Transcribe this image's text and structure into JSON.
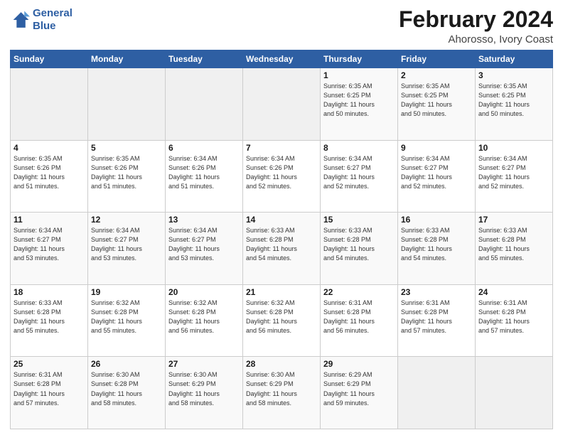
{
  "logo": {
    "line1": "General",
    "line2": "Blue"
  },
  "title": "February 2024",
  "subtitle": "Ahorosso, Ivory Coast",
  "weekdays": [
    "Sunday",
    "Monday",
    "Tuesday",
    "Wednesday",
    "Thursday",
    "Friday",
    "Saturday"
  ],
  "weeks": [
    [
      {
        "day": "",
        "info": ""
      },
      {
        "day": "",
        "info": ""
      },
      {
        "day": "",
        "info": ""
      },
      {
        "day": "",
        "info": ""
      },
      {
        "day": "1",
        "info": "Sunrise: 6:35 AM\nSunset: 6:25 PM\nDaylight: 11 hours\nand 50 minutes."
      },
      {
        "day": "2",
        "info": "Sunrise: 6:35 AM\nSunset: 6:25 PM\nDaylight: 11 hours\nand 50 minutes."
      },
      {
        "day": "3",
        "info": "Sunrise: 6:35 AM\nSunset: 6:25 PM\nDaylight: 11 hours\nand 50 minutes."
      }
    ],
    [
      {
        "day": "4",
        "info": "Sunrise: 6:35 AM\nSunset: 6:26 PM\nDaylight: 11 hours\nand 51 minutes."
      },
      {
        "day": "5",
        "info": "Sunrise: 6:35 AM\nSunset: 6:26 PM\nDaylight: 11 hours\nand 51 minutes."
      },
      {
        "day": "6",
        "info": "Sunrise: 6:34 AM\nSunset: 6:26 PM\nDaylight: 11 hours\nand 51 minutes."
      },
      {
        "day": "7",
        "info": "Sunrise: 6:34 AM\nSunset: 6:26 PM\nDaylight: 11 hours\nand 52 minutes."
      },
      {
        "day": "8",
        "info": "Sunrise: 6:34 AM\nSunset: 6:27 PM\nDaylight: 11 hours\nand 52 minutes."
      },
      {
        "day": "9",
        "info": "Sunrise: 6:34 AM\nSunset: 6:27 PM\nDaylight: 11 hours\nand 52 minutes."
      },
      {
        "day": "10",
        "info": "Sunrise: 6:34 AM\nSunset: 6:27 PM\nDaylight: 11 hours\nand 52 minutes."
      }
    ],
    [
      {
        "day": "11",
        "info": "Sunrise: 6:34 AM\nSunset: 6:27 PM\nDaylight: 11 hours\nand 53 minutes."
      },
      {
        "day": "12",
        "info": "Sunrise: 6:34 AM\nSunset: 6:27 PM\nDaylight: 11 hours\nand 53 minutes."
      },
      {
        "day": "13",
        "info": "Sunrise: 6:34 AM\nSunset: 6:27 PM\nDaylight: 11 hours\nand 53 minutes."
      },
      {
        "day": "14",
        "info": "Sunrise: 6:33 AM\nSunset: 6:28 PM\nDaylight: 11 hours\nand 54 minutes."
      },
      {
        "day": "15",
        "info": "Sunrise: 6:33 AM\nSunset: 6:28 PM\nDaylight: 11 hours\nand 54 minutes."
      },
      {
        "day": "16",
        "info": "Sunrise: 6:33 AM\nSunset: 6:28 PM\nDaylight: 11 hours\nand 54 minutes."
      },
      {
        "day": "17",
        "info": "Sunrise: 6:33 AM\nSunset: 6:28 PM\nDaylight: 11 hours\nand 55 minutes."
      }
    ],
    [
      {
        "day": "18",
        "info": "Sunrise: 6:33 AM\nSunset: 6:28 PM\nDaylight: 11 hours\nand 55 minutes."
      },
      {
        "day": "19",
        "info": "Sunrise: 6:32 AM\nSunset: 6:28 PM\nDaylight: 11 hours\nand 55 minutes."
      },
      {
        "day": "20",
        "info": "Sunrise: 6:32 AM\nSunset: 6:28 PM\nDaylight: 11 hours\nand 56 minutes."
      },
      {
        "day": "21",
        "info": "Sunrise: 6:32 AM\nSunset: 6:28 PM\nDaylight: 11 hours\nand 56 minutes."
      },
      {
        "day": "22",
        "info": "Sunrise: 6:31 AM\nSunset: 6:28 PM\nDaylight: 11 hours\nand 56 minutes."
      },
      {
        "day": "23",
        "info": "Sunrise: 6:31 AM\nSunset: 6:28 PM\nDaylight: 11 hours\nand 57 minutes."
      },
      {
        "day": "24",
        "info": "Sunrise: 6:31 AM\nSunset: 6:28 PM\nDaylight: 11 hours\nand 57 minutes."
      }
    ],
    [
      {
        "day": "25",
        "info": "Sunrise: 6:31 AM\nSunset: 6:28 PM\nDaylight: 11 hours\nand 57 minutes."
      },
      {
        "day": "26",
        "info": "Sunrise: 6:30 AM\nSunset: 6:28 PM\nDaylight: 11 hours\nand 58 minutes."
      },
      {
        "day": "27",
        "info": "Sunrise: 6:30 AM\nSunset: 6:29 PM\nDaylight: 11 hours\nand 58 minutes."
      },
      {
        "day": "28",
        "info": "Sunrise: 6:30 AM\nSunset: 6:29 PM\nDaylight: 11 hours\nand 58 minutes."
      },
      {
        "day": "29",
        "info": "Sunrise: 6:29 AM\nSunset: 6:29 PM\nDaylight: 11 hours\nand 59 minutes."
      },
      {
        "day": "",
        "info": ""
      },
      {
        "day": "",
        "info": ""
      }
    ]
  ]
}
